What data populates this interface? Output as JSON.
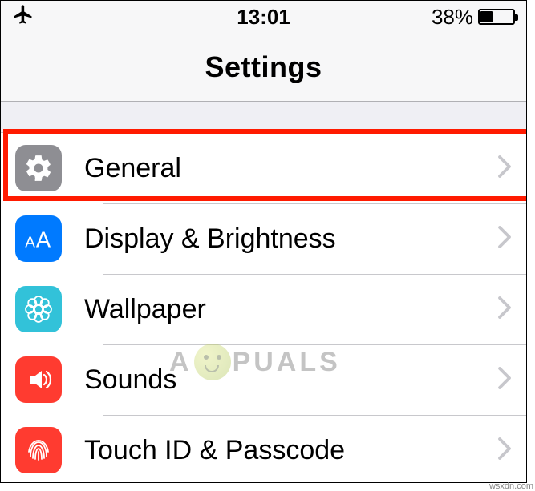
{
  "status": {
    "time": "13:01",
    "battery_text": "38%",
    "battery_level": 38,
    "airplane_mode": true
  },
  "nav": {
    "title": "Settings"
  },
  "rows": {
    "general": {
      "label": "General",
      "icon": "gear",
      "tile_color": "gray"
    },
    "display": {
      "label": "Display & Brightness",
      "icon": "text-size",
      "tile_color": "blue"
    },
    "wallpaper": {
      "label": "Wallpaper",
      "icon": "flower",
      "tile_color": "cyan"
    },
    "sounds": {
      "label": "Sounds",
      "icon": "speaker",
      "tile_color": "red"
    },
    "touchid": {
      "label": "Touch ID & Passcode",
      "icon": "fingerprint",
      "tile_color": "red"
    }
  },
  "highlight": {
    "row": "general"
  },
  "watermark": {
    "text_before": "A",
    "text_after": "PUALS"
  },
  "attribution": "wsxdn.com"
}
